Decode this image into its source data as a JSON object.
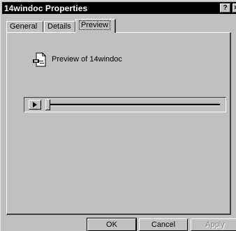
{
  "window": {
    "title": "14windoc Properties",
    "help_glyph": "?",
    "close_glyph": "×"
  },
  "tabs": [
    {
      "label": "General"
    },
    {
      "label": "Details"
    },
    {
      "label": "Preview",
      "active": true
    }
  ],
  "preview": {
    "file_label": "Preview of 14windoc",
    "icon": "document-icon"
  },
  "player": {
    "play_icon": "play-icon",
    "position": 0
  },
  "buttons": {
    "ok": "OK",
    "cancel": "Cancel",
    "apply": "Apply"
  },
  "colors": {
    "face": "#c0c0c0",
    "titlebar": "#000000",
    "disabled_text": "#808080"
  }
}
